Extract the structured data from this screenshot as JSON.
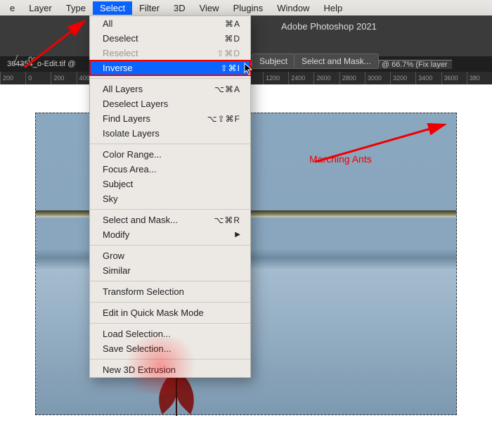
{
  "menubar": {
    "items": [
      "e",
      "Layer",
      "Type",
      "Select",
      "Filter",
      "3D",
      "View",
      "Plugins",
      "Window",
      "Help"
    ],
    "selected_index": 3
  },
  "app_title": "Adobe Photoshop 2021",
  "options_bar": {
    "angle_value": "0°",
    "subject_btn": "Subject",
    "select_and_mask_btn": "Select and Mask..."
  },
  "tabs": {
    "left_fragment": "364354_o-Edit.tif @",
    "active": "Havana Day 1 Arrival 143 Web-Edit.tif @ 66.7% (Fix layer"
  },
  "ruler_ticks": [
    "200",
    "0",
    "200",
    "400",
    "1200",
    "2400",
    "2600",
    "2800",
    "3000",
    "3200",
    "3400",
    "3600",
    "380"
  ],
  "dropdown": {
    "groups": [
      [
        {
          "label": "All",
          "shortcut": "⌘A",
          "disabled": false
        },
        {
          "label": "Deselect",
          "shortcut": "⌘D",
          "disabled": false
        },
        {
          "label": "Reselect",
          "shortcut": "⇧⌘D",
          "disabled": true
        },
        {
          "label": "Inverse",
          "shortcut": "⇧⌘I",
          "disabled": false,
          "highlight": true
        }
      ],
      [
        {
          "label": "All Layers",
          "shortcut": "⌥⌘A"
        },
        {
          "label": "Deselect Layers",
          "shortcut": ""
        },
        {
          "label": "Find Layers",
          "shortcut": "⌥⇧⌘F"
        },
        {
          "label": "Isolate Layers",
          "shortcut": ""
        }
      ],
      [
        {
          "label": "Color Range...",
          "shortcut": ""
        },
        {
          "label": "Focus Area...",
          "shortcut": ""
        },
        {
          "label": "Subject",
          "shortcut": ""
        },
        {
          "label": "Sky",
          "shortcut": ""
        }
      ],
      [
        {
          "label": "Select and Mask...",
          "shortcut": "⌥⌘R"
        },
        {
          "label": "Modify",
          "shortcut": "",
          "submenu": true
        }
      ],
      [
        {
          "label": "Grow",
          "shortcut": ""
        },
        {
          "label": "Similar",
          "shortcut": ""
        }
      ],
      [
        {
          "label": "Transform Selection",
          "shortcut": ""
        }
      ],
      [
        {
          "label": "Edit in Quick Mask Mode",
          "shortcut": ""
        }
      ],
      [
        {
          "label": "Load Selection...",
          "shortcut": ""
        },
        {
          "label": "Save Selection...",
          "shortcut": ""
        }
      ],
      [
        {
          "label": "New 3D Extrusion",
          "shortcut": ""
        }
      ]
    ]
  },
  "annotation": "Marching Ants"
}
